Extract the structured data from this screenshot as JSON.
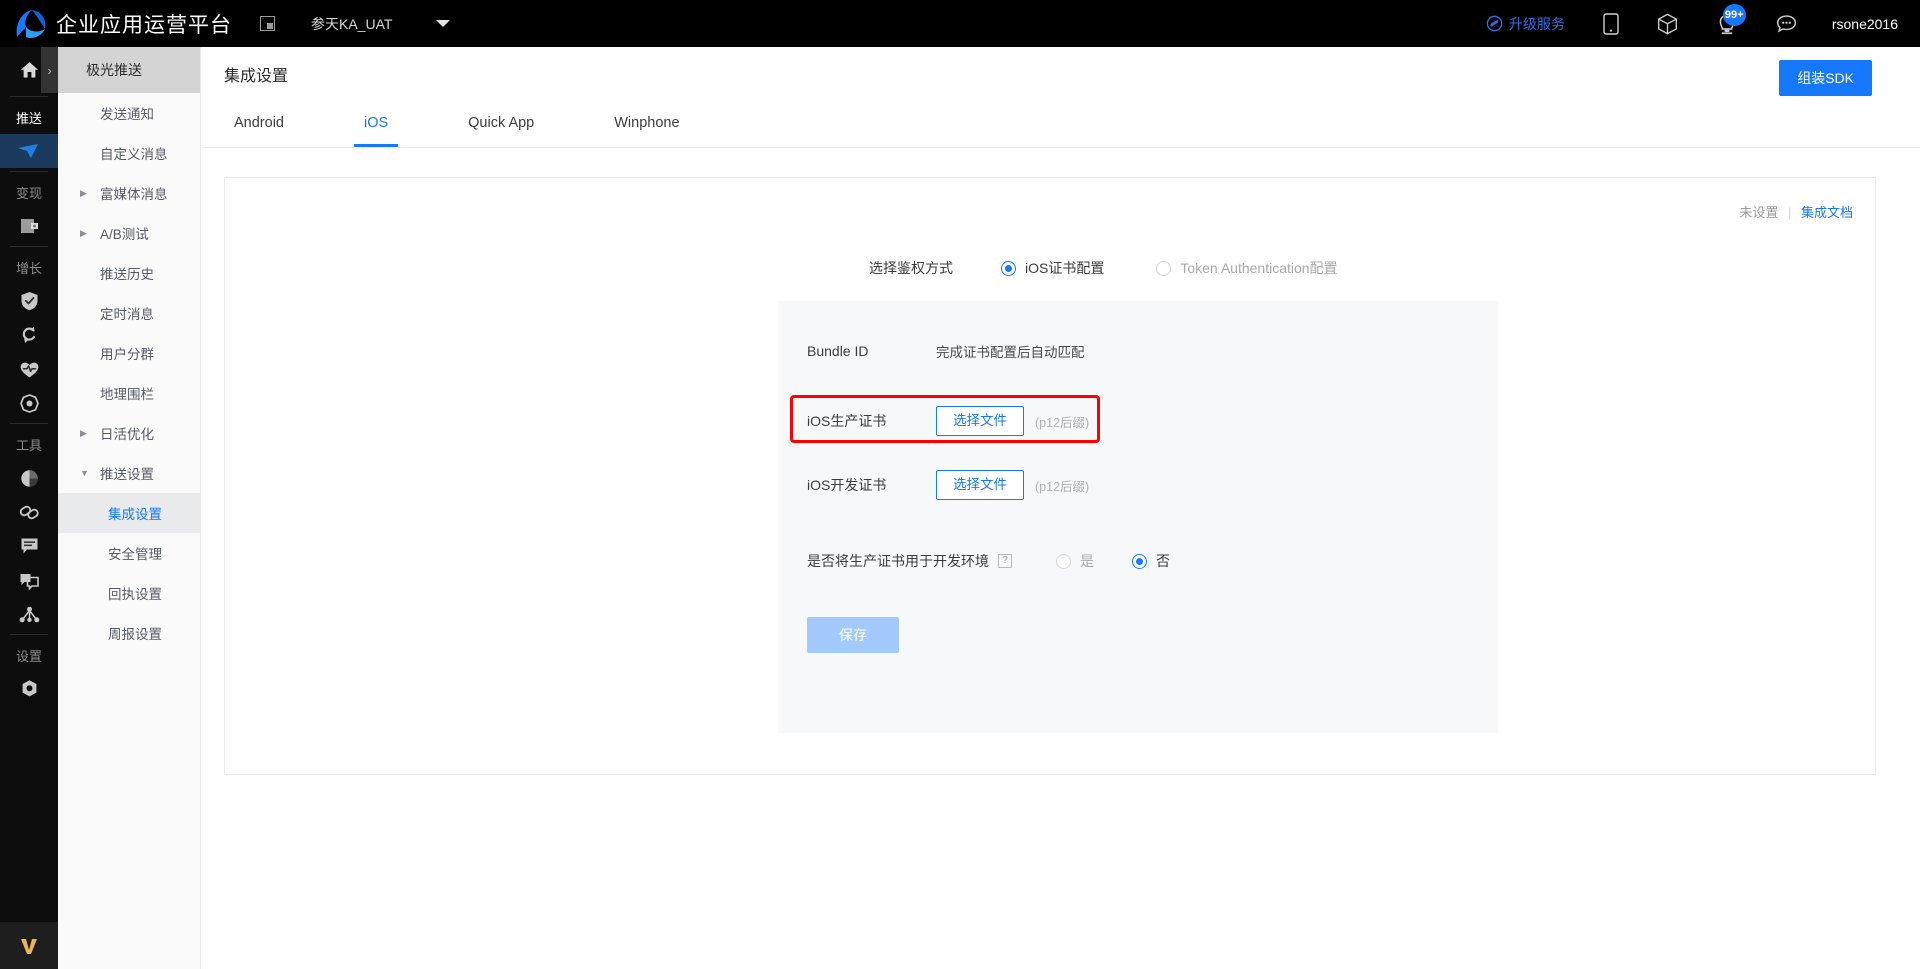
{
  "topbar": {
    "brand_title": "企业应用运营平台",
    "app_switcher_icon": "app-switcher-icon",
    "project_name": "参天KA_UAT",
    "project_caret_icon": "chevron-down-icon",
    "upgrade_label": "升级服务",
    "upgrade_icon": "diamond-icon",
    "mobile_icon": "mobile-icon",
    "package_icon": "cube-icon",
    "notification_icon": "bell-icon",
    "notification_badge": "99+",
    "message_icon": "chat-bubble-icon",
    "username": "rsone2016"
  },
  "rail": {
    "home_icon": "home-icon",
    "expand_icon": "chevron-right-icon",
    "groups": [
      {
        "label": "推送",
        "active": true,
        "items": [
          {
            "icon": "send-icon",
            "active": true
          }
        ]
      },
      {
        "label": "变现",
        "active": false,
        "items": [
          {
            "icon": "wallet-icon",
            "active": false
          }
        ]
      },
      {
        "label": "增长",
        "active": false,
        "items": [
          {
            "icon": "shield-check-icon",
            "active": false
          },
          {
            "icon": "refresh-icon",
            "active": false
          },
          {
            "icon": "heart-pulse-icon",
            "active": false
          },
          {
            "icon": "target-icon",
            "active": false
          }
        ]
      },
      {
        "label": "工具",
        "active": false,
        "items": [
          {
            "icon": "pie-chart-icon",
            "active": false
          },
          {
            "icon": "link-icon",
            "active": false
          },
          {
            "icon": "message-lines-icon",
            "active": false
          },
          {
            "icon": "share-screen-icon",
            "active": false
          },
          {
            "icon": "network-nodes-icon",
            "active": false
          }
        ]
      },
      {
        "label": "设置",
        "active": false,
        "items": [
          {
            "icon": "gear-icon",
            "active": false
          }
        ]
      }
    ],
    "bottom_logo": "v-logo-icon"
  },
  "subnav": {
    "header": "极光推送",
    "items": [
      {
        "label": "发送通知",
        "arrow": "",
        "active": false,
        "child": false
      },
      {
        "label": "自定义消息",
        "arrow": "",
        "active": false,
        "child": false
      },
      {
        "label": "富媒体消息",
        "arrow": "▶",
        "active": false,
        "child": false
      },
      {
        "label": "A/B测试",
        "arrow": "▶",
        "active": false,
        "child": false
      },
      {
        "label": "推送历史",
        "arrow": "",
        "active": false,
        "child": false
      },
      {
        "label": "定时消息",
        "arrow": "",
        "active": false,
        "child": false
      },
      {
        "label": "用户分群",
        "arrow": "",
        "active": false,
        "child": false
      },
      {
        "label": "地理围栏",
        "arrow": "",
        "active": false,
        "child": false
      },
      {
        "label": "日活优化",
        "arrow": "▶",
        "active": false,
        "child": false
      },
      {
        "label": "推送设置",
        "arrow": "▼",
        "active": false,
        "child": false
      },
      {
        "label": "集成设置",
        "arrow": "",
        "active": true,
        "child": true
      },
      {
        "label": "安全管理",
        "arrow": "",
        "active": false,
        "child": true
      },
      {
        "label": "回执设置",
        "arrow": "",
        "active": false,
        "child": true
      },
      {
        "label": "周报设置",
        "arrow": "",
        "active": false,
        "child": true
      }
    ]
  },
  "page": {
    "title": "集成设置",
    "sdk_button": "组装SDK",
    "tabs": [
      {
        "label": "Android",
        "active": false
      },
      {
        "label": "iOS",
        "active": true
      },
      {
        "label": "Quick App",
        "active": false
      },
      {
        "label": "Winphone",
        "active": false
      }
    ],
    "status_text": "未设置",
    "doc_link": "集成文档"
  },
  "form": {
    "auth_label": "选择鉴权方式",
    "auth_options": [
      {
        "label": "iOS证书配置",
        "checked": true
      },
      {
        "label": "Token Authentication配置",
        "checked": false
      }
    ],
    "bundle_id_label": "Bundle ID",
    "bundle_id_value": "完成证书配置后自动匹配",
    "prod_cert_label": "iOS生产证书",
    "prod_cert_button": "选择文件",
    "prod_cert_hint": "(p12后缀)",
    "dev_cert_label": "iOS开发证书",
    "dev_cert_button": "选择文件",
    "dev_cert_hint": "(p12后缀)",
    "env_label": "是否将生产证书用于开发环境",
    "env_help_icon": "question-mark-icon",
    "env_options": [
      {
        "label": "是",
        "checked": false
      },
      {
        "label": "否",
        "checked": true
      }
    ],
    "save_button": "保存",
    "highlight_color": "#ff0000"
  }
}
